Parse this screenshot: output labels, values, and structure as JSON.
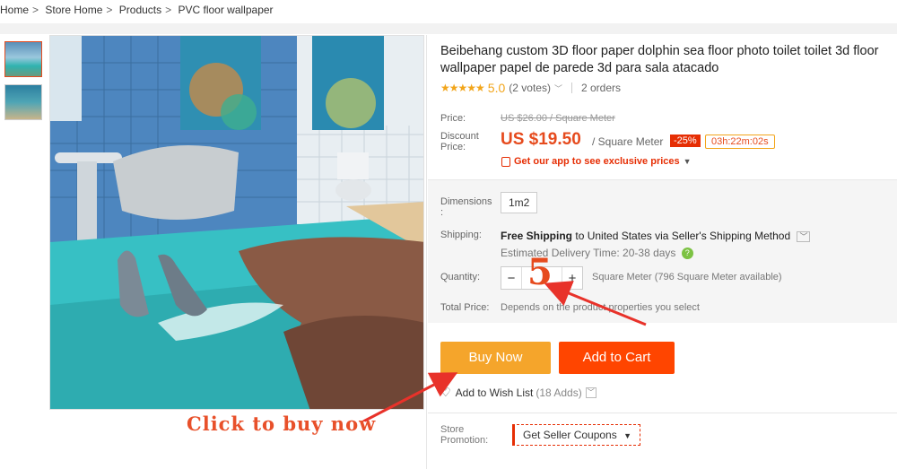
{
  "breadcrumb": [
    "Home",
    "Store Home",
    "Products",
    "PVC floor wallpaper"
  ],
  "breadcrumb_sep": ">",
  "product": {
    "title": "Beibehang custom 3D floor paper dolphin sea floor photo toilet toilet 3d floor wallpaper papel de parede 3d para sala atacado",
    "stars": "★★★★★",
    "rating": "5.0",
    "votes": "(2 votes)",
    "orders": "2 orders"
  },
  "price": {
    "label": "Price:",
    "old": "US $26.00 / Square Meter",
    "discount_label": "Discount Price:",
    "new": "US $19.50",
    "unit": "/ Square Meter",
    "percent": "-25%",
    "countdown": "03h:22m:02s",
    "app_text": "Get our app to see exclusive prices"
  },
  "dimensions": {
    "label": "Dimensions :",
    "option": "1m2"
  },
  "shipping": {
    "label": "Shipping:",
    "free": "Free Shipping",
    "to": "to United States via Seller's Shipping Method",
    "estimate_label": "Estimated Delivery Time:",
    "estimate_value": "20-38 days"
  },
  "quantity": {
    "label": "Quantity:",
    "minus": "−",
    "value": "",
    "plus": "+",
    "available": "Square Meter (796 Square Meter available)"
  },
  "total": {
    "label": "Total Price:",
    "text": "Depends on the product properties you select"
  },
  "buttons": {
    "buy": "Buy Now",
    "cart": "Add to Cart"
  },
  "wishlist": {
    "label": "Add to Wish List",
    "count": "(18 Adds)"
  },
  "promotion": {
    "label": "Store Promotion:",
    "coupon": "Get Seller Coupons"
  },
  "annotations": {
    "qty_number": "5",
    "click": "Click to buy now"
  },
  "colors": {
    "accent": "#e64b1e",
    "buy": "#f5a52b",
    "cart": "#ff4500",
    "star": "#f2a51a"
  }
}
